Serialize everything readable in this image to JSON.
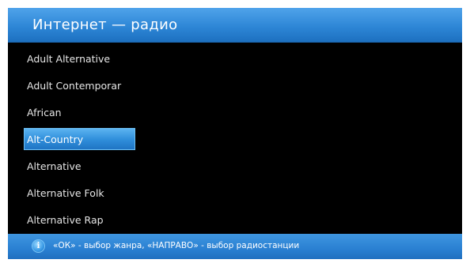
{
  "header": {
    "title": "Интернет — радио"
  },
  "genres": [
    {
      "label": "Adult Alternative",
      "selected": false
    },
    {
      "label": "Adult Contemporar",
      "selected": false
    },
    {
      "label": "African",
      "selected": false
    },
    {
      "label": "Alt-Country",
      "selected": true
    },
    {
      "label": "Alternative",
      "selected": false
    },
    {
      "label": "Alternative Folk",
      "selected": false
    },
    {
      "label": "Alternative Rap",
      "selected": false
    }
  ],
  "footer": {
    "icon": "info-icon",
    "icon_glyph": "i",
    "hint": "«ОК» - выбор жанра, «НАПРАВО» - выбор радиостанции"
  },
  "colors": {
    "accent": "#2d86d6",
    "selection": "#3190dc",
    "background": "#000000",
    "text": "#e6e6e6"
  }
}
